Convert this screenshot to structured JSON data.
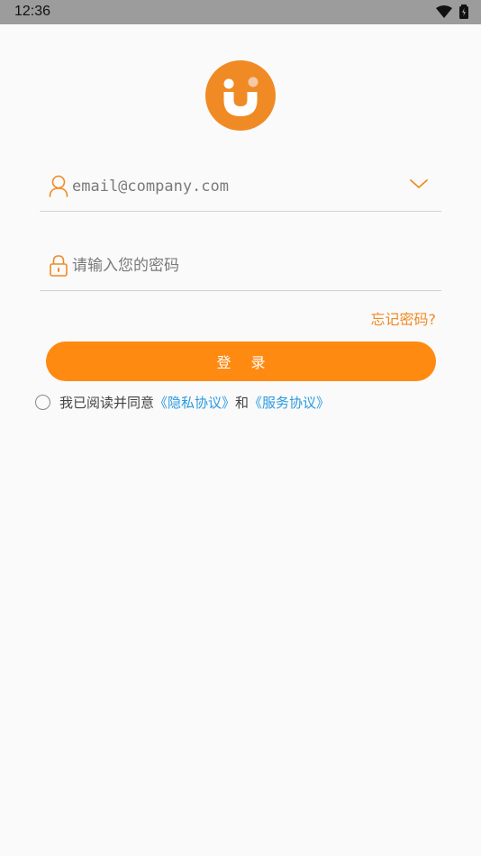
{
  "status_bar": {
    "time": "12:36"
  },
  "login_form": {
    "email_placeholder": "email@company.com",
    "password_placeholder": "请输入您的密码",
    "forgot_password": "忘记密码?",
    "login_button": "登录"
  },
  "agreement": {
    "prefix": "我已阅读并同意",
    "privacy_link": "《隐私协议》",
    "conjunction": "和",
    "service_link": "《服务协议》"
  },
  "icons": {
    "logo": "brand-logo",
    "email": "user-icon",
    "password": "lock-icon",
    "dropdown": "chevron-down-icon",
    "wifi": "wifi-icon",
    "battery": "battery-icon"
  },
  "colors": {
    "accent": "#ff8a12",
    "link": "#2a9be0",
    "background": "#fafafa",
    "status_bar": "#9c9c9c"
  }
}
